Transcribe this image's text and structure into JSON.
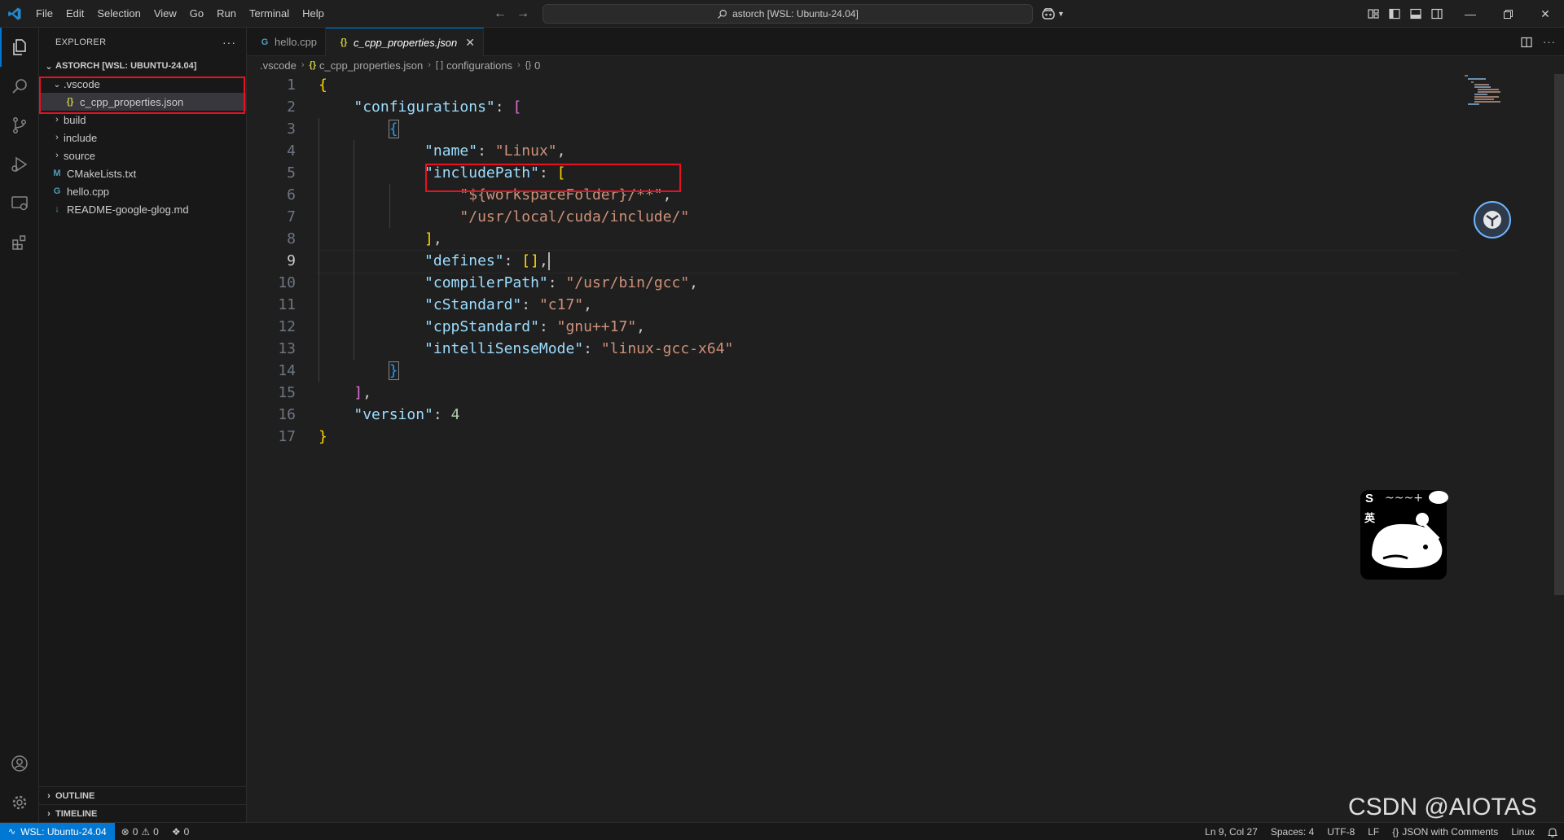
{
  "menu": [
    "File",
    "Edit",
    "Selection",
    "View",
    "Go",
    "Run",
    "Terminal",
    "Help"
  ],
  "command_center": {
    "text": "astorch [WSL: Ubuntu-24.04]"
  },
  "explorer": {
    "title": "EXPLORER",
    "folder": "ASTORCH [WSL: UBUNTU-24.04]",
    "tree": [
      {
        "label": ".vscode",
        "type": "folder",
        "expanded": true,
        "depth": 1
      },
      {
        "label": "c_cpp_properties.json",
        "type": "json",
        "depth": 2,
        "selected": true
      },
      {
        "label": "build",
        "type": "folder",
        "expanded": false,
        "depth": 1
      },
      {
        "label": "include",
        "type": "folder",
        "expanded": false,
        "depth": 1
      },
      {
        "label": "source",
        "type": "folder",
        "expanded": false,
        "depth": 1
      },
      {
        "label": "CMakeLists.txt",
        "type": "cmake",
        "depth": 1
      },
      {
        "label": "hello.cpp",
        "type": "cpp",
        "depth": 1
      },
      {
        "label": "README-google-glog.md",
        "type": "md",
        "depth": 1
      }
    ],
    "outline": "OUTLINE",
    "timeline": "TIMELINE"
  },
  "tabs": [
    {
      "label": "hello.cpp",
      "icon": "cpp",
      "active": false
    },
    {
      "label": "c_cpp_properties.json",
      "icon": "json",
      "active": true
    }
  ],
  "breadcrumbs": [
    ".vscode",
    "c_cpp_properties.json",
    "configurations",
    "0"
  ],
  "code_lines": [
    "{",
    "    \"configurations\": [",
    "        {",
    "            \"name\": \"Linux\",",
    "            \"includePath\": [",
    "                \"${workspaceFolder}/**\",",
    "                \"/usr/local/cuda/include/\"",
    "            ],",
    "            \"defines\": [],",
    "            \"compilerPath\": \"/usr/bin/gcc\",",
    "            \"cStandard\": \"c17\",",
    "            \"cppStandard\": \"gnu++17\",",
    "            \"intelliSenseMode\": \"linux-gcc-x64\"",
    "        }",
    "    ],",
    "    \"version\": 4",
    "}"
  ],
  "current_line": 9,
  "sticker_text": {
    "s": "S",
    "ying": "英"
  },
  "watermark": "CSDN @AIOTAS",
  "status": {
    "remote": "WSL: Ubuntu-24.04",
    "errors": "0",
    "warnings": "0",
    "ports": "0",
    "position": "Ln 9, Col 27",
    "spaces": "Spaces: 4",
    "encoding": "UTF-8",
    "eol": "LF",
    "language": "JSON with Comments",
    "platform": "Linux"
  },
  "colors": {
    "accent": "#0078d4",
    "highlight_box": "#e81123",
    "key": "#9cdcfe",
    "string": "#ce9178",
    "number": "#b5cea8"
  }
}
